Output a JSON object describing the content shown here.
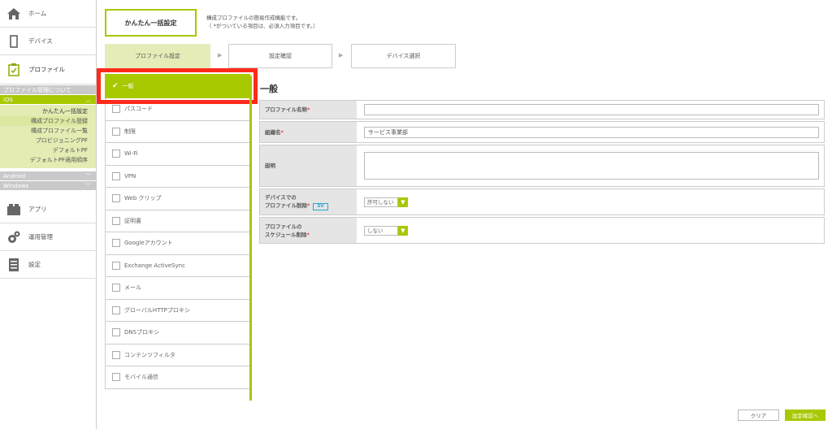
{
  "sidebar": {
    "home": "ホーム",
    "device": "デバイス",
    "profile": "プロファイル",
    "profile_mgmt": "プロファイル管理について",
    "ios": {
      "label": "iOS",
      "items": [
        "かんたん一括設定",
        "構成プロファイル登録",
        "構成プロファイル一覧",
        "プロビジョニングPF",
        "デフォルトPF",
        "デフォルトPF適用順序"
      ]
    },
    "android": "Android",
    "windows": "Windows",
    "app": "アプリ",
    "ops": "運用管理",
    "settings": "設定"
  },
  "header": {
    "button": "かんたん一括設定",
    "desc_line1": "構成プロファイルの簡易作成機能です。",
    "desc_line2": "（ *がついている項目は、必須入力項目です。）"
  },
  "steps": [
    "プロファイル設定",
    "設定確認",
    "デバイス選択"
  ],
  "categories": [
    "一般",
    "パスコード",
    "制限",
    "Wi-Fi",
    "VPN",
    "Web クリップ",
    "証明書",
    "Googleアカウント",
    "Exchange ActiveSync",
    "メール",
    "グローバルHTTPプロキシ",
    "DNSプロキシ",
    "コンテンツフィルタ",
    "モバイル通信"
  ],
  "form": {
    "title": "一般",
    "profile_name_label": "プロファイル名称",
    "profile_name_value": "",
    "org_label": "組織名",
    "org_value": "サービス事業部",
    "desc_label": "説明",
    "delete_label_1": "デバイスでの",
    "delete_label_2": "プロファイル削除",
    "delete_badge": "SV",
    "delete_value": "許可しない",
    "sched_label_1": "プロファイルの",
    "sched_label_2": "スケジュール削除",
    "sched_value": "しない",
    "required_mark": "*"
  },
  "buttons": {
    "clear": "クリア",
    "next": "設定確認へ"
  },
  "colors": {
    "accent": "#a8c800",
    "highlight": "#ff2a1a"
  }
}
